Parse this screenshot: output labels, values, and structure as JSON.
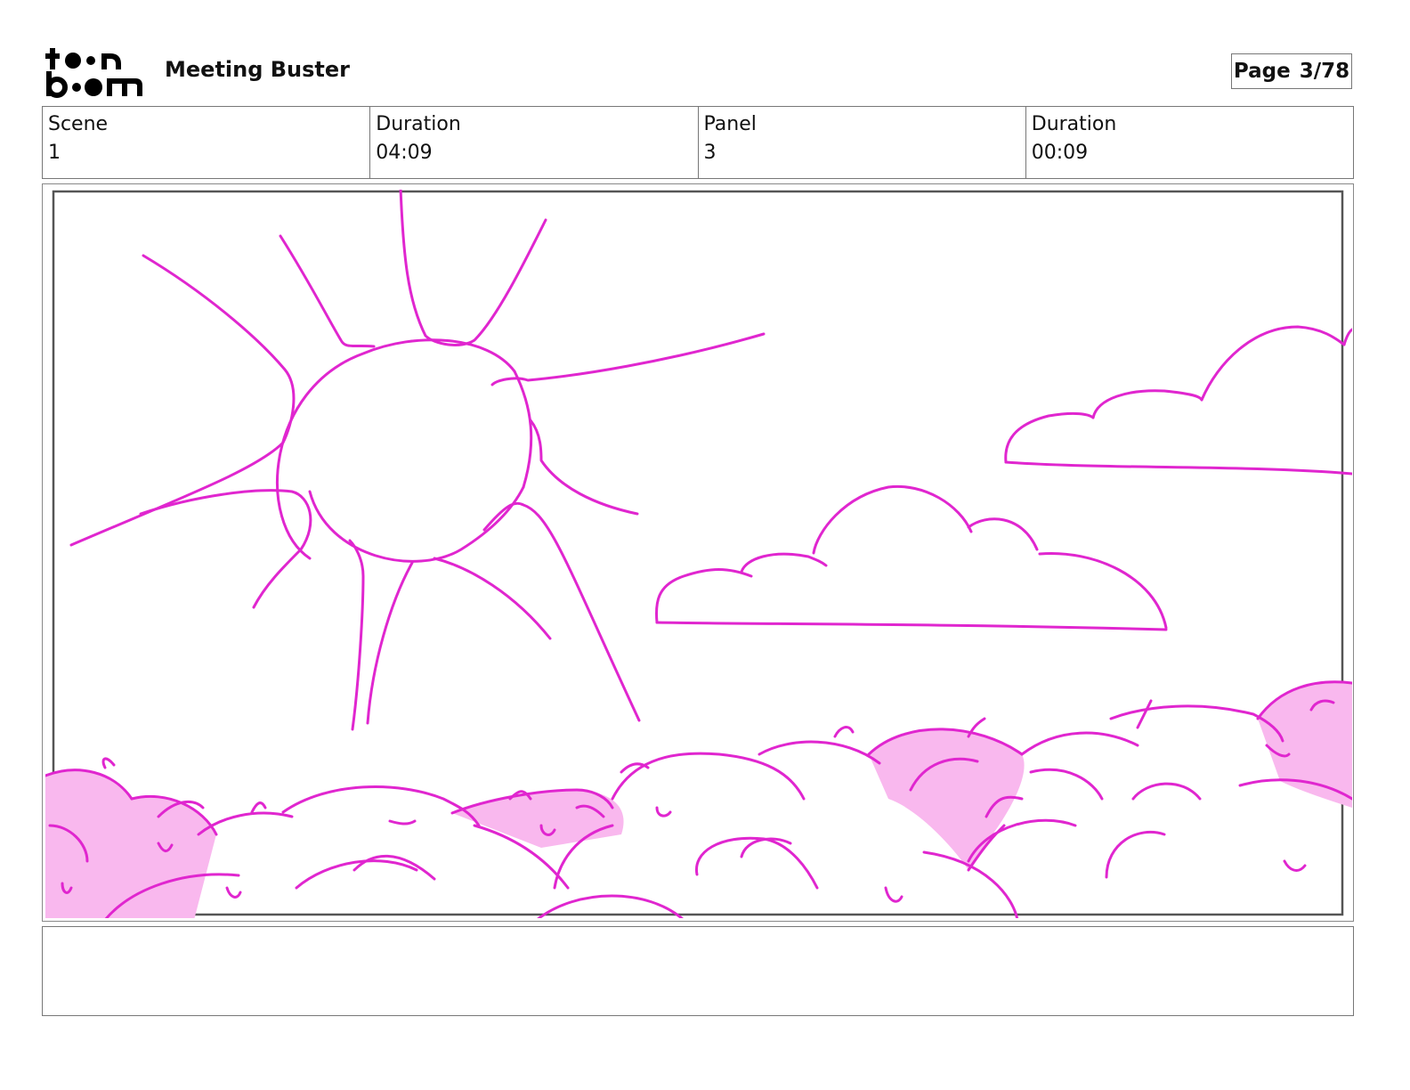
{
  "header": {
    "logo_text_top": "toon",
    "logo_text_bottom": "boom",
    "project_title": "Meeting Buster",
    "page_label": "Page",
    "page_value": "3/78"
  },
  "info": {
    "scene_label": "Scene",
    "scene_value": "1",
    "scene_duration_label": "Duration",
    "scene_duration_value": "04:09",
    "panel_label": "Panel",
    "panel_value": "3",
    "panel_duration_label": "Duration",
    "panel_duration_value": "00:09"
  },
  "drawing": {
    "stroke_color": "#e026cf",
    "fill_color": "#f9b8ee",
    "frame_color": "#555555"
  },
  "notes": {
    "text": ""
  }
}
